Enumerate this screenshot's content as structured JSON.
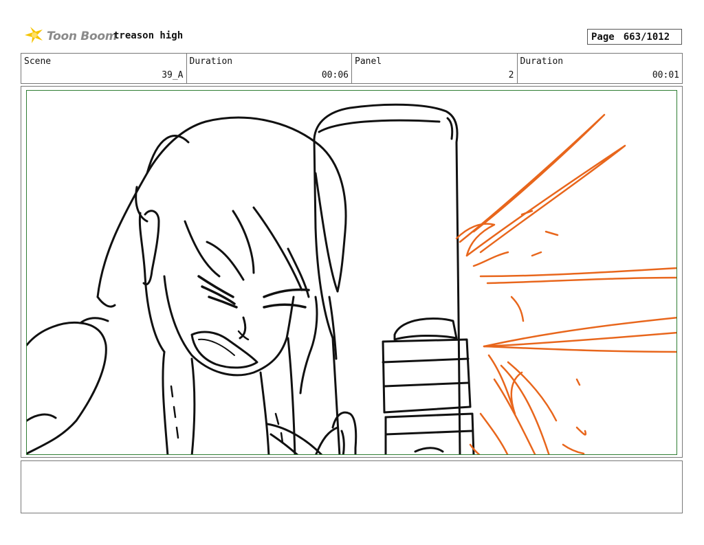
{
  "header": {
    "brand": "Toon Boom",
    "project_title": "treason high",
    "page_label": "Page",
    "page_number": "663/1012"
  },
  "info": {
    "scene_label": "Scene",
    "scene_value": "39_A",
    "scene_duration_label": "Duration",
    "scene_duration_value": "00:06",
    "panel_label": "Panel",
    "panel_value": "2",
    "panel_duration_label": "Duration",
    "panel_duration_value": "00:01"
  },
  "colors": {
    "line": "#111111",
    "effect": "#e8661c",
    "frame": "#2e7d32",
    "logo_yellow": "#f5c400"
  }
}
